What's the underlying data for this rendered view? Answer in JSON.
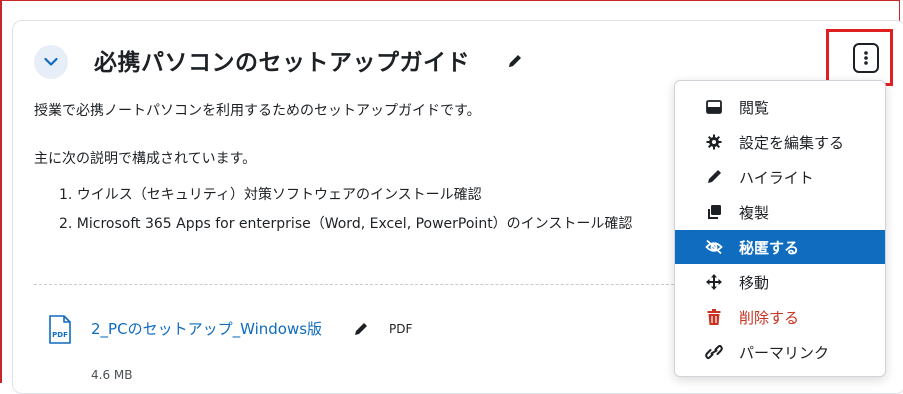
{
  "section": {
    "title": "必携パソコンのセットアップガイド",
    "description": "授業で必携ノートパソコンを利用するためのセットアップガイドです。",
    "intro": "主に次の説明で構成されています。",
    "list": [
      "1. ウイルス（セキュリティ）対策ソフトウェアのインストール確認",
      "2. Microsoft 365 Apps for enterprise（Word, Excel, PowerPoint）のインストール確認"
    ]
  },
  "activity": {
    "icon": "pdf-icon",
    "name": "2_PCのセットアップ_Windows版",
    "type": "PDF",
    "size": "4.6 MB"
  },
  "menu": {
    "items": [
      {
        "label": "閲覧",
        "icon": "view-icon"
      },
      {
        "label": "設定を編集する",
        "icon": "gear-icon"
      },
      {
        "label": "ハイライト",
        "icon": "highlight-icon"
      },
      {
        "label": "複製",
        "icon": "duplicate-icon"
      },
      {
        "label": "秘匿する",
        "icon": "eye-slash-icon",
        "state": "active"
      },
      {
        "label": "移動",
        "icon": "move-icon"
      },
      {
        "label": "削除する",
        "icon": "trash-icon",
        "state": "danger"
      },
      {
        "label": "パーマリンク",
        "icon": "link-icon"
      }
    ]
  },
  "colors": {
    "accent": "#0f6cbf",
    "danger": "#ca3120",
    "highlight_frame": "#e02020"
  }
}
